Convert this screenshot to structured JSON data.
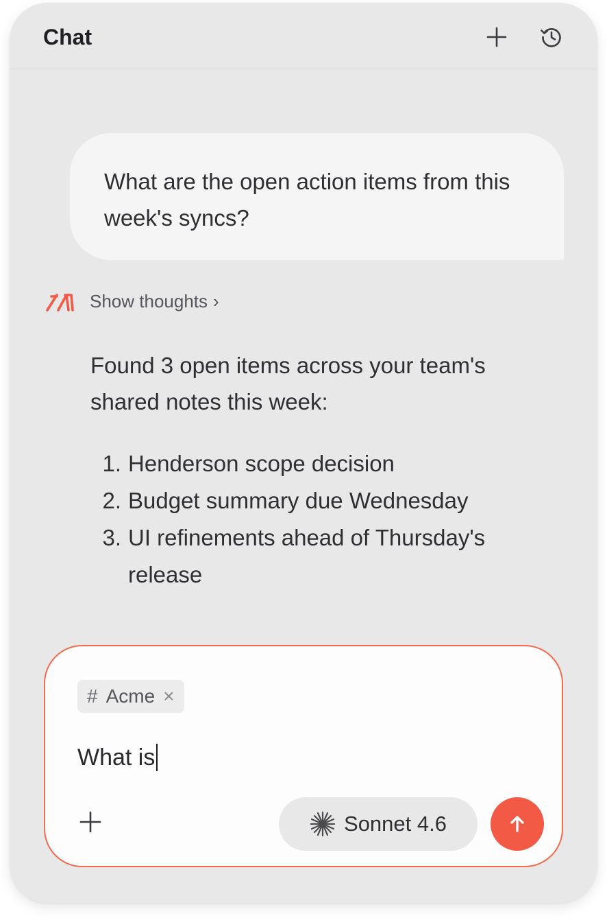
{
  "header": {
    "title": "Chat",
    "new_chat_icon": "plus-icon",
    "history_icon": "history-icon"
  },
  "conversation": {
    "user_message": "What are the open action items from this week's syncs?",
    "thoughts_label": "Show thoughts",
    "thoughts_chevron": "›",
    "answer_intro": "Found 3 open items across your team's shared notes this week:",
    "items": [
      {
        "num": "1.",
        "text": "Henderson scope decision"
      },
      {
        "num": "2.",
        "text": "Budget summary due Wednesday"
      },
      {
        "num": "3.",
        "text": "UI refinements ahead of Thursday's release"
      }
    ]
  },
  "composer": {
    "context_chip": {
      "hash": "#",
      "label": "Acme",
      "remove": "×"
    },
    "input_value": "What is",
    "model_label": "Sonnet 4.6",
    "add_icon": "plus-icon",
    "model_icon": "sparkle-icon",
    "send_icon": "arrow-up-icon"
  },
  "colors": {
    "accent": "#f25a45",
    "composer_border": "#f26b50",
    "panel_bg": "#e9e8e9",
    "bubble_bg": "#f5f5f5"
  }
}
